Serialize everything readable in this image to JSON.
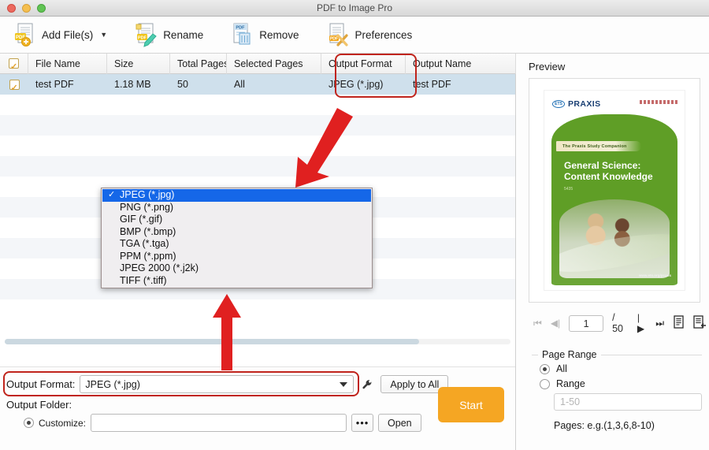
{
  "window": {
    "title": "PDF to Image Pro",
    "traffic_lights": [
      "close-red",
      "minimize-yellow",
      "zoom-green"
    ]
  },
  "toolbar": {
    "items": [
      {
        "label": "Add File(s)",
        "icon": "pdf-add-icon",
        "has_caret": true,
        "caret": "▼"
      },
      {
        "label": "Rename",
        "icon": "pdf-rename-icon",
        "has_caret": false,
        "caret": ""
      },
      {
        "label": "Remove",
        "icon": "pdf-remove-icon",
        "has_caret": false,
        "caret": ""
      },
      {
        "label": "Preferences",
        "icon": "pdf-preferences-icon",
        "has_caret": false,
        "caret": ""
      }
    ]
  },
  "table": {
    "headers": [
      "File Name",
      "Size",
      "Total Pages",
      "Selected Pages",
      "Output Format",
      "Output Name"
    ],
    "rows": [
      {
        "checked": true,
        "file_name": "test PDF",
        "size": "1.18 MB",
        "total_pages": "50",
        "selected_pages": "All",
        "output_format": "JPEG (*.jpg)",
        "output_name": "test PDF"
      }
    ]
  },
  "dropdown": {
    "selected": "JPEG (*.jpg)",
    "check_glyph": "✓",
    "options": [
      "JPEG (*.jpg)",
      "PNG (*.png)",
      "GIF (*.gif)",
      "BMP (*.bmp)",
      "TGA (*.tga)",
      "PPM (*.ppm)",
      "JPEG 2000 (*.j2k)",
      "TIFF (*.tiff)"
    ]
  },
  "bottom": {
    "output_format_label": "Output Format:",
    "output_format_value": "JPEG (*.jpg)",
    "wrench_icon": "wrench-icon",
    "apply_to_all_label": "Apply to All",
    "output_folder_label": "Output Folder:",
    "customize_label": "Customize:",
    "customize_path": "",
    "browse_label": "•••",
    "open_label": "Open",
    "start_label": "Start",
    "start_color": "#f5a623"
  },
  "preview": {
    "title": "Preview",
    "page_current": "1",
    "page_total": "/ 50",
    "nav": {
      "first": "⏮",
      "prev": "◀|",
      "next": "|▶",
      "last": "⏭",
      "single_page_icon": "document-icon",
      "facing_page_icon": "document-export-icon"
    },
    "document": {
      "brand": "PRAXIS",
      "brand_mark": "ETS",
      "ribbon": "The Praxis Study Companion",
      "title_line1": "General Science:",
      "title_line2": "Content Knowledge",
      "subcode": "5435",
      "url": "www.ets.org/praxis"
    }
  },
  "page_range": {
    "legend": "Page Range",
    "all_label": "All",
    "range_label": "Range",
    "all_selected": true,
    "range_placeholder": "1-50",
    "hint": "Pages: e.g.(1,3,6,8-10)"
  },
  "annotations": {
    "highlight_color": "#c0241c",
    "arrow_color": "#e02020"
  }
}
